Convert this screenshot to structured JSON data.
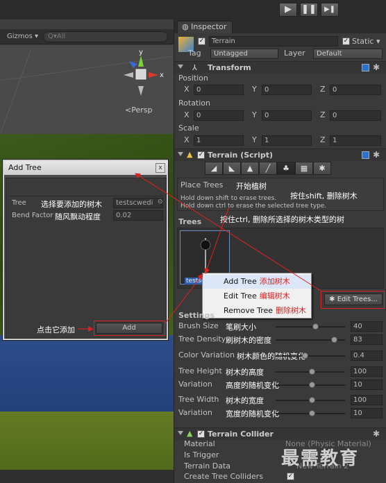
{
  "playbar": {
    "play_icon": "play-icon",
    "pause_icon": "pause-icon",
    "step_icon": "step-icon",
    "play_glyph": "▶",
    "pause_glyph": "❚❚",
    "step_glyph": "▶❚"
  },
  "scene": {
    "gizmos_label": "Gizmos ▾",
    "search_placeholder": "Q▾All",
    "persp_label": "<Persp",
    "axis_y": "y",
    "axis_x": "x"
  },
  "add_tree_dialog": {
    "title": "Add Tree",
    "close": "x",
    "tree_label": "Tree",
    "tree_note": "选择要添加的树木",
    "tree_value": "testscwedi",
    "bend_label": "Bend Factor",
    "bend_note": "随风飘动程度",
    "bend_value": "0.02",
    "add_button": "Add",
    "add_note": "点击它添加"
  },
  "inspector": {
    "tab": "Inspector",
    "object_name": "Terrain",
    "static_label": "Static ▾",
    "tag_label": "Tag",
    "tag_value": "Untagged",
    "layer_label": "Layer",
    "layer_value": "Default",
    "transform": {
      "title": "Transform",
      "position_label": "Position",
      "rotation_label": "Rotation",
      "scale_label": "Scale",
      "x": "X",
      "y": "Y",
      "z": "Z",
      "position": [
        "0",
        "0",
        "0"
      ],
      "rotation": [
        "0",
        "0",
        "0"
      ],
      "scale": [
        "1",
        "1",
        "1"
      ]
    },
    "terrain_script": {
      "title": "Terrain (Script)",
      "place_trees": "Place Trees",
      "place_trees_note": "开始植树",
      "hint1": "Hold down shift to erase trees.",
      "hint1_note": "按住shift, 删除树木",
      "hint2": "Hold down ctrl to erase the selected tree type.",
      "hint2_note": "按住ctrl, 删除所选择的树木类型的树",
      "trees_label": "Trees",
      "tree_thumb_label": "testsc"
    },
    "context_menu": {
      "items": [
        {
          "label": "Add Tree",
          "note": "添加树木"
        },
        {
          "label": "Edit Tree",
          "note": "编辑树木"
        },
        {
          "label": "Remove Tree",
          "note": "删除树木"
        }
      ]
    },
    "edit_trees_button": "Edit Trees...",
    "settings_label": "Settings",
    "settings": [
      {
        "label": "Brush Size",
        "note": "笔刷大小",
        "value": "40",
        "fraction": 0.55
      },
      {
        "label": "Tree Density",
        "note": "刷树木的密度",
        "value": "83",
        "fraction": 0.83
      },
      {
        "label": "Color Variation",
        "note": "树木颜色的随机变化",
        "value": "0.4",
        "fraction": 0.4
      },
      {
        "label": "Tree Height",
        "note": "树木的高度",
        "value": "100",
        "fraction": 0.5
      },
      {
        "label": "Variation",
        "note": "高度的随机变化",
        "value": "10",
        "fraction": 0.5
      },
      {
        "label": "Tree Width",
        "note": "树木的宽度",
        "value": "100",
        "fraction": 0.5
      },
      {
        "label": "Variation",
        "note": "宽度的随机变化",
        "value": "10",
        "fraction": 0.5
      }
    ],
    "collider": {
      "title": "Terrain Collider",
      "material_label": "Material",
      "material_value": "None (Physic Material)",
      "trigger_label": "Is Trigger",
      "terrain_data_label": "Terrain Data",
      "terrain_data_value": "New Terrain 2",
      "create_colliders_label": "Create Tree Colliders"
    }
  },
  "watermark": "最需教育",
  "colors": {
    "annotation_red": "#e02020",
    "selection_blue": "#3060b0"
  }
}
